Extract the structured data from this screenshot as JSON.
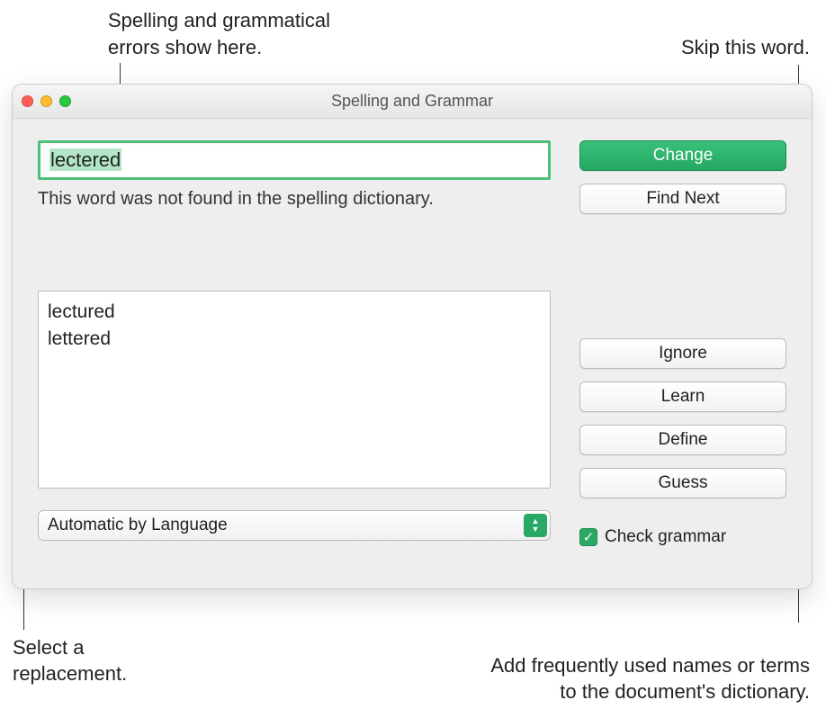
{
  "callouts": {
    "top_left": "Spelling and grammatical errors show here.",
    "top_right": "Skip this word.",
    "bottom_left": "Select a replacement.",
    "bottom_right": "Add frequently used names or terms to the document's dictionary."
  },
  "window": {
    "title": "Spelling and Grammar"
  },
  "error_field": {
    "value": "lectered"
  },
  "error_message": "This word was not found in the spelling dictionary.",
  "suggestions": [
    "lectured",
    "lettered"
  ],
  "language_popup": "Automatic by Language",
  "check_grammar_label": "Check grammar",
  "check_grammar_checked": true,
  "buttons": {
    "change": "Change",
    "find_next": "Find Next",
    "ignore": "Ignore",
    "learn": "Learn",
    "define": "Define",
    "guess": "Guess"
  }
}
